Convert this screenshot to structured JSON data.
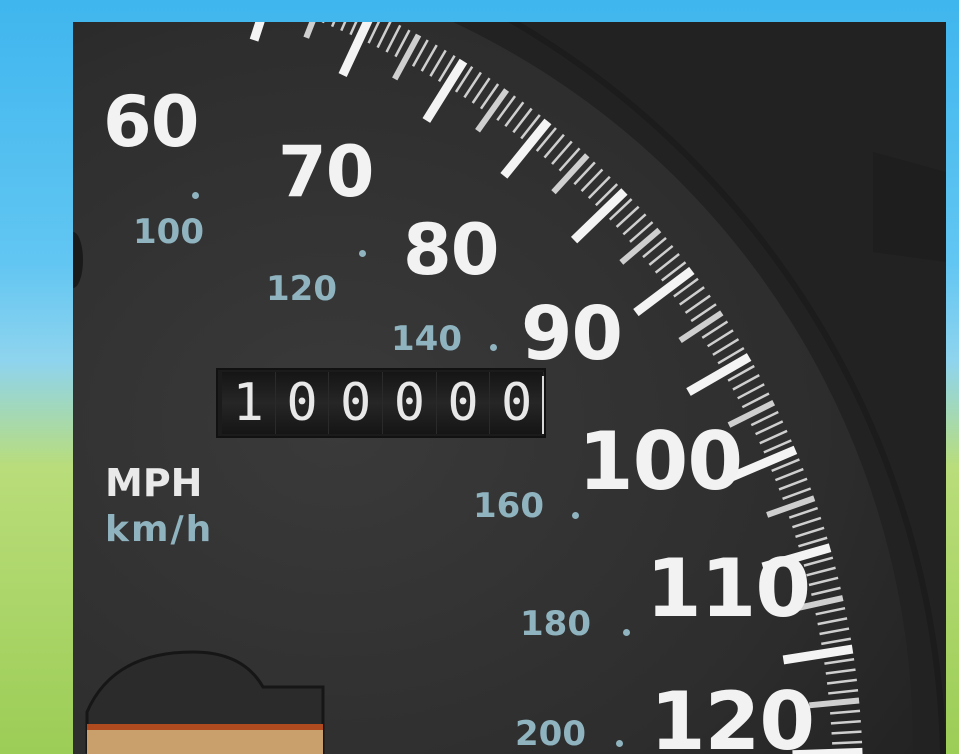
{
  "mph_labels": [
    "60",
    "70",
    "80",
    "90",
    "100",
    "110",
    "120"
  ],
  "kmh_labels": [
    "100",
    "120",
    "140",
    "160",
    "180",
    "200"
  ],
  "odometer": {
    "digits": [
      "1",
      "0",
      "0",
      "0",
      "0",
      "0"
    ]
  },
  "units": {
    "primary": "MPH",
    "secondary": "km/h"
  },
  "colors": {
    "dial_face": "#2f2f2f",
    "mph_text": "#f2f2f2",
    "kmh_text": "#8fb3bf",
    "background_sky": "#3fb6ee",
    "background_grass": "#9ccd56"
  }
}
